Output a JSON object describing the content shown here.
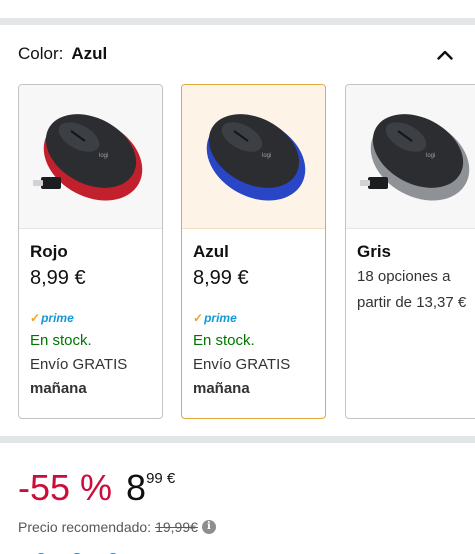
{
  "color_selector": {
    "label": "Color:",
    "selected": "Azul"
  },
  "variants": [
    {
      "name": "Rojo",
      "price": "8,99 €",
      "prime": "prime",
      "stock": "En stock.",
      "shipping": "Envío GRATIS",
      "shipping_date": "mañana",
      "mouse_color": "#c3202e"
    },
    {
      "name": "Azul",
      "price": "8,99 €",
      "prime": "prime",
      "stock": "En stock.",
      "shipping": "Envío GRATIS",
      "shipping_date": "mañana",
      "mouse_color": "#2846c6",
      "selected": true
    },
    {
      "name": "Gris",
      "options_line1": "18 opciones a",
      "options_line2": "partir de 13,37 €",
      "mouse_color": "#8e9296"
    }
  ],
  "pricing": {
    "discount": "-55 %",
    "price_whole": "8",
    "price_fraction": "99 €",
    "recommended_label": "Precio recomendado:",
    "recommended_price": "19,99€",
    "info_glyph": "i"
  },
  "icons": {
    "chevron": "chevron-up-icon",
    "info": "info-icon",
    "prime_check": "check-icon"
  }
}
